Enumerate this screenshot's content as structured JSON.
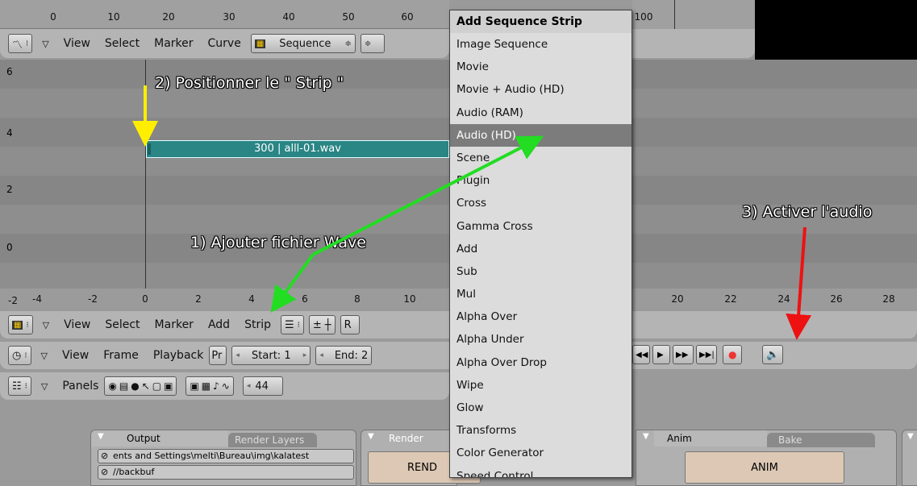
{
  "ipo": {
    "ruler_ticks": [
      "0",
      "10",
      "20",
      "30",
      "40",
      "50",
      "60",
      "100"
    ],
    "menus": [
      "View",
      "Select",
      "Marker",
      "Curve"
    ],
    "sequence_label": "Sequence"
  },
  "seq": {
    "y_labels": [
      "6",
      "4",
      "2",
      "0",
      "-2"
    ],
    "x_ticks": [
      "-4",
      "-2",
      "0",
      "2",
      "4",
      "6",
      "8",
      "10",
      "20",
      "22",
      "24",
      "26",
      "28"
    ],
    "strip_label": "300 | alll-01.wav",
    "menus": [
      "View",
      "Select",
      "Marker",
      "Add",
      "Strip"
    ],
    "r_label": "R"
  },
  "timeline": {
    "menus": [
      "View",
      "Frame",
      "Playback"
    ],
    "pr": "Pr",
    "start": "Start: 1",
    "end": "End: 2"
  },
  "buttons": {
    "panels_label": "Panels",
    "frame_value": "44"
  },
  "render": {
    "output_tab": "Output",
    "layers_tab": "Render Layers",
    "path1": "ents and Settings\\melti\\Bureau\\img\\kalatest",
    "path2": "//backbuf",
    "render_title": "Render",
    "rend_button": "REND",
    "anim_tab": "Anim",
    "bake_tab": "Bake",
    "anim_button": "ANIM"
  },
  "annotations": {
    "step1": "1) Ajouter fichier Wave",
    "step2": "2) Positionner le \" Strip \"",
    "step3": "3) Activer l'audio"
  },
  "menu": {
    "title": "Add Sequence Strip",
    "items": [
      "Image Sequence",
      "Movie",
      "Movie + Audio (HD)",
      "Audio (RAM)",
      "Audio (HD)",
      "Scene",
      "Plugin",
      "Cross",
      "Gamma Cross",
      "Add",
      "Sub",
      "Mul",
      "Alpha Over",
      "Alpha Under",
      "Alpha Over Drop",
      "Wipe",
      "Glow",
      "Transforms",
      "Color Generator",
      "Speed Control"
    ],
    "selected_index": 4
  },
  "colors": {
    "arrow_yellow": "#ffee00",
    "arrow_green": "#22dd22",
    "arrow_red": "#ee1111",
    "strip": "#2a8585"
  }
}
